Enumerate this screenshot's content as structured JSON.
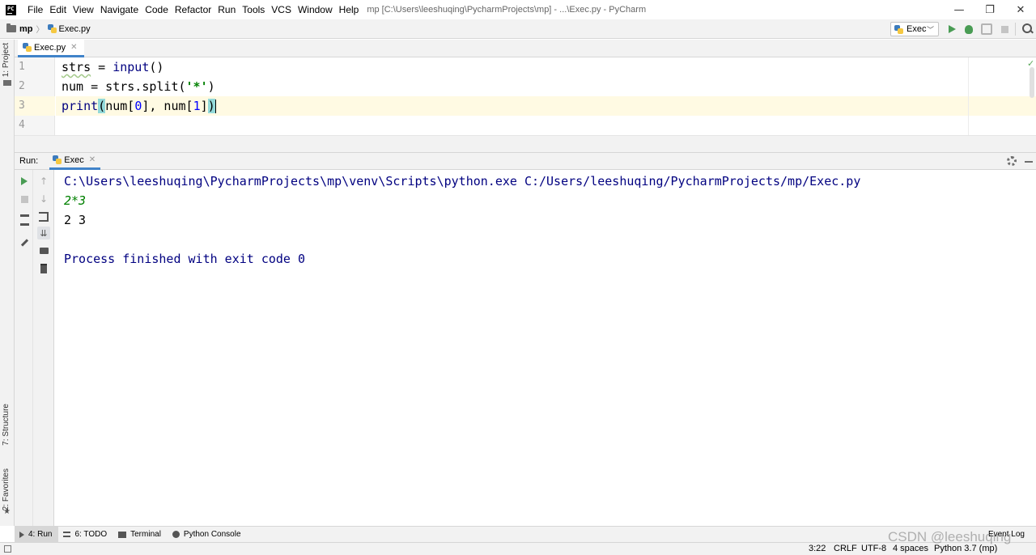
{
  "titlebar": {
    "menus": [
      "File",
      "Edit",
      "View",
      "Navigate",
      "Code",
      "Refactor",
      "Run",
      "Tools",
      "VCS",
      "Window",
      "Help"
    ],
    "title": "mp [C:\\Users\\leeshuqing\\PycharmProjects\\mp] - ...\\Exec.py - PyCharm",
    "buttons": [
      "—",
      "❐",
      "✕"
    ]
  },
  "navbar": {
    "project": "mp",
    "file": "Exec.py",
    "run_config": "Exec"
  },
  "left_strip": {
    "project_label": "1: Project",
    "structure_label": "7: Structure",
    "favorites_label": "2: Favorites"
  },
  "editor": {
    "tab_label": "Exec.py",
    "line_numbers": [
      "1",
      "2",
      "3",
      "4"
    ],
    "lines": {
      "l1_var": "strs",
      "l1_eq": " = ",
      "l1_fn": "input",
      "l1_args": "()",
      "l2_a": "num = strs.split(",
      "l2_str": "'*'",
      "l2_b": ")",
      "l3_fn": "print",
      "l3_open": "(",
      "l3_a": "num[",
      "l3_n0": "0",
      "l3_b": "], num[",
      "l3_n1": "1",
      "l3_c": "]",
      "l3_close": ")"
    }
  },
  "run_panel": {
    "title": "Run:",
    "tab_label": "Exec"
  },
  "console": {
    "command": "C:\\Users\\leeshuqing\\PycharmProjects\\mp\\venv\\Scripts\\python.exe C:/Users/leeshuqing/PycharmProjects/mp/Exec.py",
    "input": "2*3",
    "output": "2 3",
    "exit": "Process finished with exit code 0"
  },
  "bottom_tools": {
    "run": "4: Run",
    "todo": "6: TODO",
    "terminal": "Terminal",
    "python_console": "Python Console",
    "event_log": "Event Log"
  },
  "statusbar": {
    "position": "3:22",
    "line_sep": "CRLF",
    "encoding": "UTF-8",
    "indent": "4 spaces",
    "interpreter": "Python 3.7 (mp)"
  },
  "watermark": "CSDN @leeshuqing",
  "colors": {
    "accent": "#4083c9",
    "run_green": "#499c54",
    "current_line": "#fffae3",
    "console_blue": "#000080",
    "console_input_green": "#008000"
  }
}
